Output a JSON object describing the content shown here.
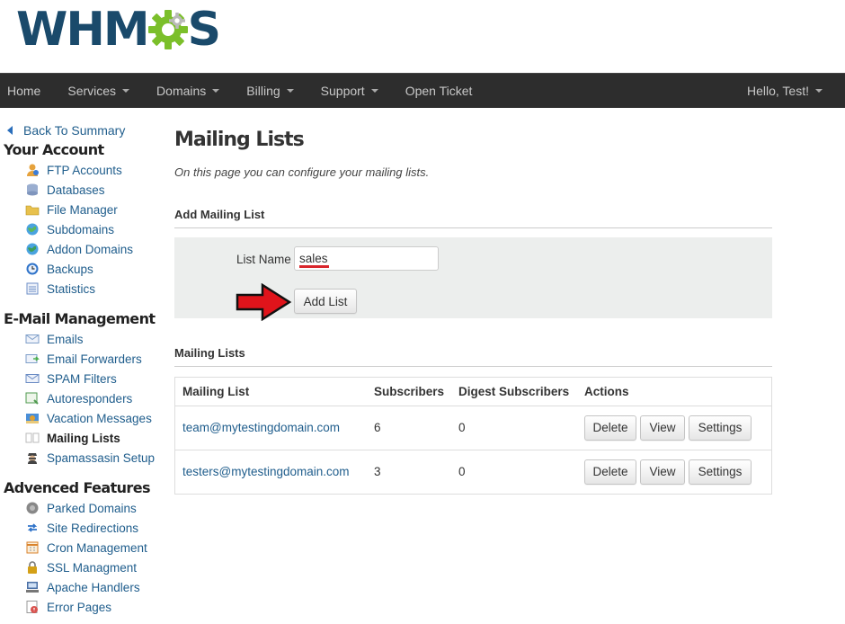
{
  "logo": {
    "text_left": "WHM",
    "text_right": "S"
  },
  "nav": {
    "items": [
      {
        "label": "Home",
        "caret": false
      },
      {
        "label": "Services",
        "caret": true
      },
      {
        "label": "Domains",
        "caret": true
      },
      {
        "label": "Billing",
        "caret": true
      },
      {
        "label": "Support",
        "caret": true
      },
      {
        "label": "Open Ticket",
        "caret": false
      }
    ],
    "user": "Hello, Test!"
  },
  "sidebar": {
    "back": "Back To Summary",
    "sections": [
      {
        "heading": "Your Account",
        "items": [
          {
            "label": "FTP Accounts",
            "icon": "ftp-icon",
            "color": "#e6a23c"
          },
          {
            "label": "Databases",
            "icon": "database-icon",
            "color": "#9aaed0"
          },
          {
            "label": "File Manager",
            "icon": "folder-icon",
            "color": "#e8c14d"
          },
          {
            "label": "Subdomains",
            "icon": "globe-icon",
            "color": "#4aa3df"
          },
          {
            "label": "Addon Domains",
            "icon": "globe-plus-icon",
            "color": "#3d9e5a"
          },
          {
            "label": "Backups",
            "icon": "clock-icon",
            "color": "#2f73c9"
          },
          {
            "label": "Statistics",
            "icon": "chart-icon",
            "color": "#6d8fc7"
          }
        ]
      },
      {
        "heading": "E-Mail Management",
        "items": [
          {
            "label": "Emails",
            "icon": "envelope-icon",
            "color": "#7f9fc9"
          },
          {
            "label": "Email Forwarders",
            "icon": "envelope-forward-icon",
            "color": "#4caf50"
          },
          {
            "label": "SPAM Filters",
            "icon": "spam-filter-icon",
            "color": "#6b8cc4"
          },
          {
            "label": "Autoresponders",
            "icon": "autoresponder-icon",
            "color": "#4f9a4f"
          },
          {
            "label": "Vacation Messages",
            "icon": "vacation-icon",
            "color": "#e0a030"
          },
          {
            "label": "Mailing Lists",
            "icon": "list-icon",
            "color": "#bbbbbb",
            "active": true
          },
          {
            "label": "Spamassasin Setup",
            "icon": "spy-icon",
            "color": "#444444"
          }
        ]
      },
      {
        "heading": "Advenced Features",
        "items": [
          {
            "label": "Parked Domains",
            "icon": "parked-icon",
            "color": "#888888"
          },
          {
            "label": "Site Redirections",
            "icon": "redirect-icon",
            "color": "#2f73c9"
          },
          {
            "label": "Cron Management",
            "icon": "cron-icon",
            "color": "#d9822b"
          },
          {
            "label": "SSL Managment",
            "icon": "lock-icon",
            "color": "#d4a017"
          },
          {
            "label": "Apache Handlers",
            "icon": "server-icon",
            "color": "#4a6fa5"
          },
          {
            "label": "Error Pages",
            "icon": "error-page-icon",
            "color": "#d9534f"
          }
        ]
      }
    ]
  },
  "main": {
    "title": "Mailing Lists",
    "description": "On this page you can configure your mailing lists.",
    "add_section": {
      "title": "Add Mailing List",
      "label": "List Name",
      "value": "sales",
      "button": "Add List"
    },
    "lists_section": {
      "title": "Mailing Lists",
      "headers": [
        "Mailing List",
        "Subscribers",
        "Digest Subscribers",
        "Actions"
      ],
      "rows": [
        {
          "email": "team@mytestingdomain.com",
          "subscribers": "6",
          "digest": "0"
        },
        {
          "email": "testers@mytestingdomain.com",
          "subscribers": "3",
          "digest": "0"
        }
      ],
      "actions": {
        "delete": "Delete",
        "view": "View",
        "settings": "Settings"
      }
    }
  },
  "colors": {
    "brand_dark": "#1a4a6b",
    "brand_green": "#7bbf2a",
    "navbar": "#2d2d2d",
    "link": "#1f5d8c",
    "arrow": "#e0141b"
  }
}
